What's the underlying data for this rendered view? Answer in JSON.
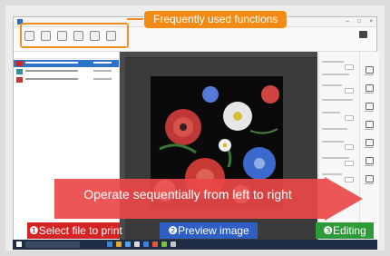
{
  "callout": {
    "label": "Frequently used functions"
  },
  "banner": {
    "text": "Operate sequentially from left to right"
  },
  "steps": [
    {
      "label": "❶Select file to print"
    },
    {
      "label": "❷Preview image"
    },
    {
      "label": "❸Editing"
    }
  ],
  "colors": {
    "callout": "#f28a16",
    "arrow": "#ec4848",
    "step1": "#d42323",
    "step2": "#2f5fc2",
    "step3": "#2e9a3a",
    "selection": "#2f73c9"
  },
  "files": {
    "rows": [
      {
        "thumb_color": "#c22a2a",
        "selected": true
      },
      {
        "thumb_color": "#3a8a9a",
        "selected": false
      },
      {
        "thumb_color": "#b83a3a",
        "selected": false
      }
    ]
  },
  "icons": [
    "window-minimize-icon",
    "window-maximize-icon",
    "window-close-icon",
    "gear-icon",
    "printer-icon",
    "windows-start-icon"
  ]
}
